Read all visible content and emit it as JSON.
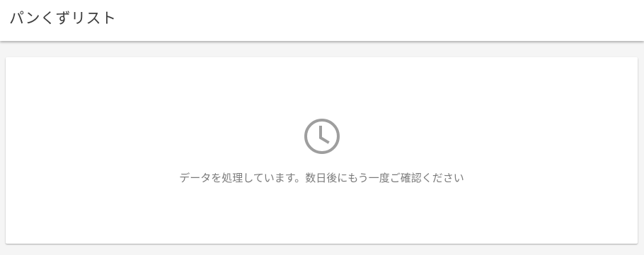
{
  "header": {
    "title": "パンくずリスト"
  },
  "status_card": {
    "icon": "clock-icon",
    "message": "データを処理しています。数日後にもう一度ご確認ください"
  },
  "colors": {
    "page_background": "#f5f5f5",
    "header_background": "#ffffff",
    "card_background": "#ffffff",
    "title_text": "#3c3c3c",
    "message_text": "#7a7a7a",
    "icon": "#9e9e9e"
  }
}
